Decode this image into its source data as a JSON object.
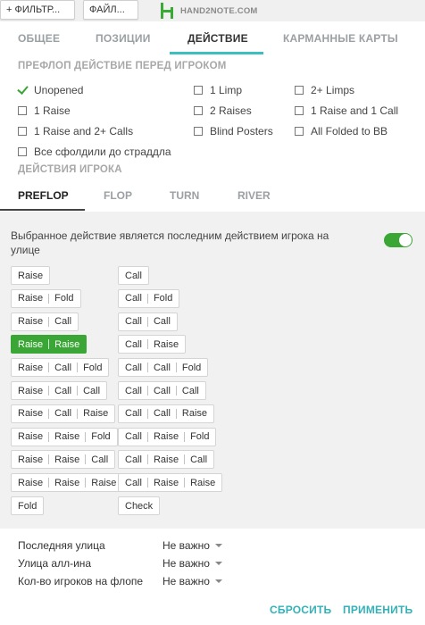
{
  "toolbar": {
    "filter_label": "+ ФИЛЬТР...",
    "file_label": "ФАЙЛ...",
    "logo_text": "HAND2NOTE.COM"
  },
  "tabs": [
    "ОБЩЕЕ",
    "ПОЗИЦИИ",
    "ДЕЙСТВИЕ",
    "КАРМАННЫЕ КАРТЫ"
  ],
  "active_tab": "ДЕЙСТВИЕ",
  "preflop_header": "ПРЕФЛОП ДЕЙСТВИЕ ПЕРЕД ИГРОКОМ",
  "preflop_options": [
    {
      "label": "Unopened",
      "checked": true
    },
    {
      "label": "1 Limp",
      "checked": false
    },
    {
      "label": "2+ Limps",
      "checked": false
    },
    {
      "label": "1 Raise",
      "checked": false
    },
    {
      "label": "2 Raises",
      "checked": false
    },
    {
      "label": "1 Raise and 1 Call",
      "checked": false
    },
    {
      "label": "1 Raise and 2+ Calls",
      "checked": false
    },
    {
      "label": "Blind Posters",
      "checked": false
    },
    {
      "label": "All Folded to BB",
      "checked": false
    },
    {
      "label": "Все сфолдили до страддла",
      "checked": false
    }
  ],
  "player_actions_header": "ДЕЙСТВИЯ ИГРОКА",
  "streets": [
    "PREFLOP",
    "FLOP",
    "TURN",
    "RIVER"
  ],
  "active_street": "PREFLOP",
  "toggle_label": "Выбранное действие является последним действием игрока на улице",
  "toggle_on": true,
  "actions_left": [
    [
      "Raise"
    ],
    [
      "Raise",
      "Fold"
    ],
    [
      "Raise",
      "Call"
    ],
    [
      "Raise",
      "Raise"
    ],
    [
      "Raise",
      "Call",
      "Fold"
    ],
    [
      "Raise",
      "Call",
      "Call"
    ],
    [
      "Raise",
      "Call",
      "Raise"
    ],
    [
      "Raise",
      "Raise",
      "Fold"
    ],
    [
      "Raise",
      "Raise",
      "Call"
    ],
    [
      "Raise",
      "Raise",
      "Raise"
    ],
    [
      "Fold"
    ]
  ],
  "actions_right": [
    [
      "Call"
    ],
    [
      "Call",
      "Fold"
    ],
    [
      "Call",
      "Call"
    ],
    [
      "Call",
      "Raise"
    ],
    [
      "Call",
      "Call",
      "Fold"
    ],
    [
      "Call",
      "Call",
      "Call"
    ],
    [
      "Call",
      "Call",
      "Raise"
    ],
    [
      "Call",
      "Raise",
      "Fold"
    ],
    [
      "Call",
      "Raise",
      "Call"
    ],
    [
      "Call",
      "Raise",
      "Raise"
    ],
    [
      "Check"
    ]
  ],
  "selected_action": "Raise | Raise",
  "bottom_filters": [
    {
      "label": "Последняя улица",
      "value": "Не важно"
    },
    {
      "label": "Улица алл-ина",
      "value": "Не важно"
    },
    {
      "label": "Кол-во игроков на флопе",
      "value": "Не важно"
    }
  ],
  "reset_label": "СБРОСИТЬ",
  "apply_label": "ПРИМЕНИТЬ",
  "colors": {
    "accent_green": "#3aa635",
    "accent_teal": "#32b1b6",
    "tab_underline": "#3bbfc0"
  }
}
